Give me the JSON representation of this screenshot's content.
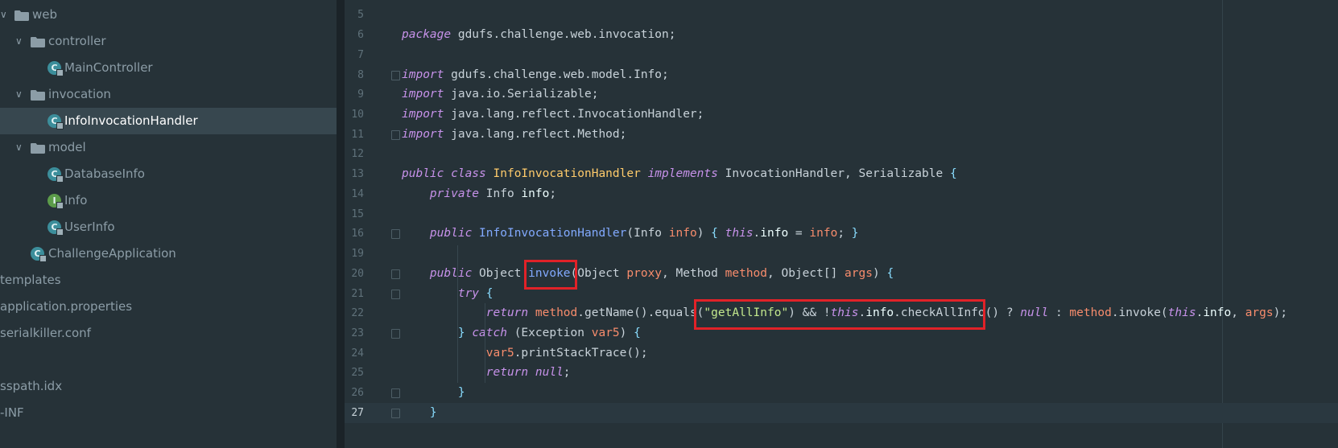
{
  "project_tree": {
    "items": [
      {
        "label": "web",
        "type": "folder",
        "expanded": true
      },
      {
        "label": "controller",
        "type": "folder",
        "expanded": true
      },
      {
        "label": "MainController",
        "type": "class",
        "icon": "class-icon"
      },
      {
        "label": "invocation",
        "type": "folder",
        "expanded": true
      },
      {
        "label": "InfoInvocationHandler",
        "type": "class",
        "icon": "class-icon",
        "selected": true
      },
      {
        "label": "model",
        "type": "folder",
        "expanded": true
      },
      {
        "label": "DatabaseInfo",
        "type": "class",
        "icon": "class-icon"
      },
      {
        "label": "Info",
        "type": "interface",
        "icon": "interface-icon"
      },
      {
        "label": "UserInfo",
        "type": "class",
        "icon": "class-icon"
      },
      {
        "label": "ChallengeApplication",
        "type": "class",
        "icon": "spring-class-icon"
      },
      {
        "label": "templates",
        "type": "folder"
      },
      {
        "label": "application.properties",
        "type": "file"
      },
      {
        "label": "serialkiller.conf",
        "type": "file"
      },
      {
        "label": "sspath.idx",
        "type": "file"
      },
      {
        "label": "-INF",
        "type": "folder"
      }
    ]
  },
  "editor": {
    "current_line": 27,
    "highlight_color": "#e12228",
    "lines": [
      {
        "n": "5",
        "tokens": []
      },
      {
        "n": "6",
        "tokens": [
          [
            "kw",
            "package"
          ],
          [
            "t",
            " gdufs.challenge.web.invocation;"
          ]
        ]
      },
      {
        "n": "7",
        "tokens": []
      },
      {
        "n": "8",
        "tokens": [
          [
            "kw",
            "import"
          ],
          [
            "t",
            " gdufs.challenge.web.model.Info;"
          ]
        ]
      },
      {
        "n": "9",
        "tokens": [
          [
            "kw",
            "import"
          ],
          [
            "t",
            " java.io.Serializable;"
          ]
        ]
      },
      {
        "n": "10",
        "tokens": [
          [
            "kw",
            "import"
          ],
          [
            "t",
            " java.lang.reflect.InvocationHandler;"
          ]
        ]
      },
      {
        "n": "11",
        "tokens": [
          [
            "kw",
            "import"
          ],
          [
            "t",
            " java.lang.reflect.Method;"
          ]
        ]
      },
      {
        "n": "12",
        "tokens": []
      },
      {
        "n": "13",
        "tokens": [
          [
            "kw",
            "public class"
          ],
          [
            "t",
            " "
          ],
          [
            "cls",
            "InfoInvocationHandler"
          ],
          [
            "t",
            " "
          ],
          [
            "kw",
            "implements"
          ],
          [
            "t",
            " InvocationHandler, Serializable "
          ],
          [
            "pun",
            "{"
          ]
        ]
      },
      {
        "n": "14",
        "tokens": [
          [
            "t",
            "    "
          ],
          [
            "kw",
            "private"
          ],
          [
            "t",
            " Info "
          ],
          [
            "fld",
            "info"
          ],
          [
            "t",
            ";"
          ]
        ]
      },
      {
        "n": "15",
        "tokens": []
      },
      {
        "n": "16",
        "tokens": [
          [
            "t",
            "    "
          ],
          [
            "kw",
            "public"
          ],
          [
            "t",
            " "
          ],
          [
            "mth",
            "InfoInvocationHandler"
          ],
          [
            "t",
            "(Info "
          ],
          [
            "prm",
            "info"
          ],
          [
            "t",
            ") "
          ],
          [
            "pun",
            "{"
          ],
          [
            "t",
            " "
          ],
          [
            "kw",
            "this"
          ],
          [
            "t",
            "."
          ],
          [
            "fld",
            "info"
          ],
          [
            "t",
            " = "
          ],
          [
            "prm",
            "info"
          ],
          [
            "t",
            "; "
          ],
          [
            "pun",
            "}"
          ]
        ]
      },
      {
        "n": "19",
        "tokens": []
      },
      {
        "n": "20",
        "tokens": [
          [
            "t",
            "    "
          ],
          [
            "kw",
            "public"
          ],
          [
            "t",
            " Object "
          ],
          [
            "mth",
            "invoke"
          ],
          [
            "t",
            "(Object "
          ],
          [
            "prm",
            "proxy"
          ],
          [
            "t",
            ", Method "
          ],
          [
            "prm",
            "method"
          ],
          [
            "t",
            ", Object[] "
          ],
          [
            "prm",
            "args"
          ],
          [
            "t",
            ") "
          ],
          [
            "pun",
            "{"
          ]
        ]
      },
      {
        "n": "21",
        "tokens": [
          [
            "t",
            "        "
          ],
          [
            "kw",
            "try"
          ],
          [
            "t",
            " "
          ],
          [
            "pun",
            "{"
          ]
        ]
      },
      {
        "n": "22",
        "tokens": [
          [
            "t",
            "            "
          ],
          [
            "kw",
            "return"
          ],
          [
            "t",
            " "
          ],
          [
            "prm",
            "method"
          ],
          [
            "t",
            ".getName().equals("
          ],
          [
            "str",
            "\"getAllInfo\""
          ],
          [
            "t",
            ") && !"
          ],
          [
            "kw",
            "this"
          ],
          [
            "t",
            "."
          ],
          [
            "fld",
            "info"
          ],
          [
            "t",
            ".checkAllInfo() ? "
          ],
          [
            "kw",
            "null"
          ],
          [
            "t",
            " : "
          ],
          [
            "prm",
            "method"
          ],
          [
            "t",
            ".invoke("
          ],
          [
            "kw",
            "this"
          ],
          [
            "t",
            "."
          ],
          [
            "fld",
            "info"
          ],
          [
            "t",
            ", "
          ],
          [
            "prm",
            "args"
          ],
          [
            "t",
            ");"
          ]
        ]
      },
      {
        "n": "23",
        "tokens": [
          [
            "t",
            "        "
          ],
          [
            "pun",
            "}"
          ],
          [
            "t",
            " "
          ],
          [
            "kw",
            "catch"
          ],
          [
            "t",
            " (Exception "
          ],
          [
            "prm",
            "var5"
          ],
          [
            "t",
            ") "
          ],
          [
            "pun",
            "{"
          ]
        ]
      },
      {
        "n": "24",
        "tokens": [
          [
            "t",
            "            "
          ],
          [
            "prm",
            "var5"
          ],
          [
            "t",
            ".printStackTrace();"
          ]
        ]
      },
      {
        "n": "25",
        "tokens": [
          [
            "t",
            "            "
          ],
          [
            "kw",
            "return null"
          ],
          [
            "t",
            ";"
          ]
        ]
      },
      {
        "n": "26",
        "tokens": [
          [
            "t",
            "        "
          ],
          [
            "pun",
            "}"
          ]
        ]
      },
      {
        "n": "27",
        "tokens": [
          [
            "t",
            "    "
          ],
          [
            "pun",
            "}"
          ]
        ]
      }
    ]
  }
}
